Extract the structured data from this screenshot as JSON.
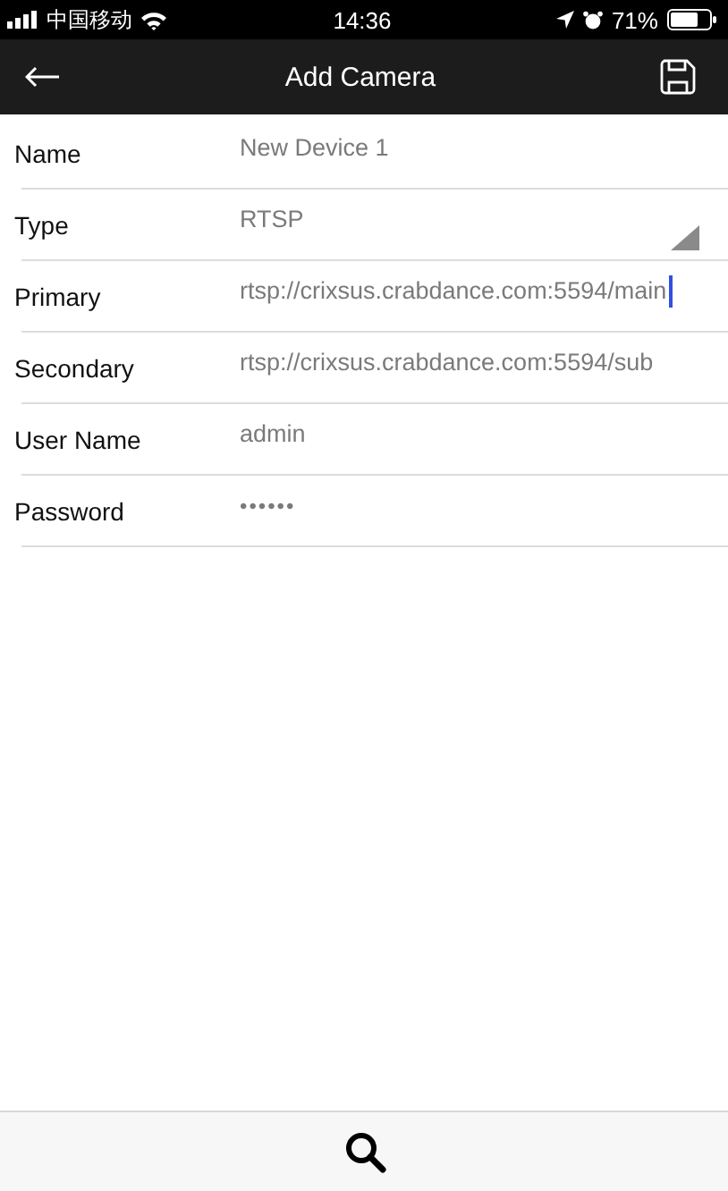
{
  "status_bar": {
    "carrier": "中国移动",
    "time": "14:36",
    "battery": "71%"
  },
  "nav_bar": {
    "title": "Add Camera"
  },
  "fields": [
    {
      "kind": "text",
      "label": "Name",
      "value": "New Device 1",
      "focused": false
    },
    {
      "kind": "select",
      "label": "Type",
      "value": "RTSP",
      "focused": false
    },
    {
      "kind": "text",
      "label": "Primary",
      "value": "rtsp://crixsus.crabdance.com:5594/main",
      "focused": true
    },
    {
      "kind": "text",
      "label": "Secondary",
      "value": "rtsp://crixsus.crabdance.com:5594/sub",
      "focused": false
    },
    {
      "kind": "text",
      "label": "User Name",
      "value": "admin",
      "focused": false
    },
    {
      "kind": "password",
      "label": "Password",
      "value": "••••••",
      "focused": false
    }
  ]
}
